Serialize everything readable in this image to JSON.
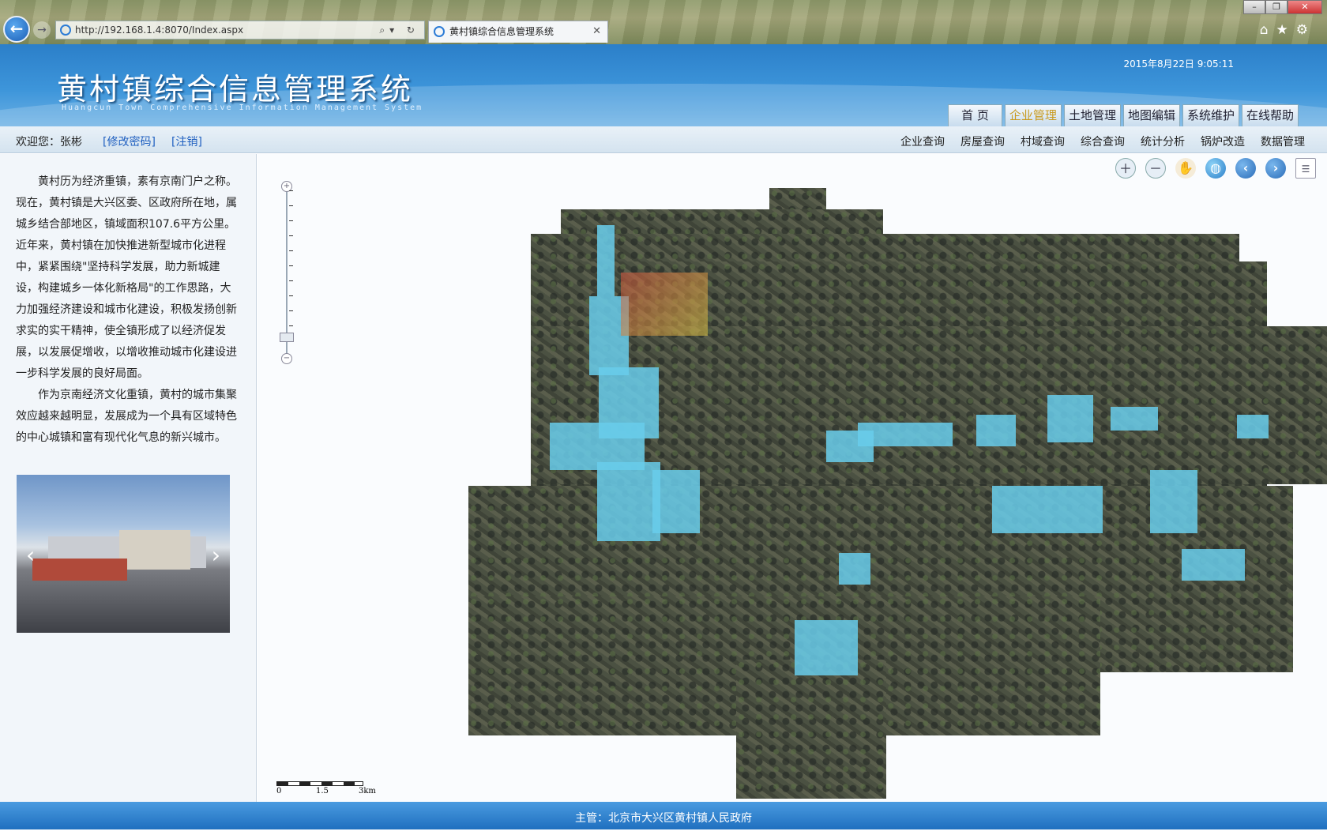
{
  "browser": {
    "url": "http://192.168.1.4:8070/Index.aspx",
    "tab_title": "黄村镇综合信息管理系统",
    "window_buttons": [
      "–",
      "❐",
      "✕"
    ]
  },
  "header": {
    "title_cn": "黄村镇综合信息管理系统",
    "title_en": "Huangcun Town Comprehensive Information Management System",
    "datetime": "2015年8月22日 9:05:11",
    "main_nav": [
      "首 页",
      "企业管理",
      "土地管理",
      "地图编辑",
      "系统维护",
      "在线帮助"
    ],
    "active_nav": "企业管理"
  },
  "subbar": {
    "welcome": "欢迎您：张彬",
    "change_password": "[修改密码]",
    "logout": "[注销]",
    "sub_nav": [
      "企业查询",
      "房屋查询",
      "村域查询",
      "综合查询",
      "统计分析",
      "锅炉改造",
      "数据管理"
    ]
  },
  "sidebar": {
    "paragraphs": [
      "黄村历为经济重镇，素有京南门户之称。现在，黄村镇是大兴区委、区政府所在地，属城乡结合部地区，镇域面积107.6平方公里。近年来，黄村镇在加快推进新型城市化进程中，紧紧围绕\"坚持科学发展，助力新城建设，构建城乡一体化新格局\"的工作思路，大力加强经济建设和城市化建设，积极发扬创新求实的实干精神，使全镇形成了以经济促发展，以发展促增收，以增收推动城市化建设进一步科学发展的良好局面。",
      "作为京南经济文化重镇，黄村的城市集聚效应越来越明显，发展成为一个具有区域特色的中心城镇和富有现代化气息的新兴城市。"
    ],
    "photo_prev": "‹",
    "photo_next": "›"
  },
  "map": {
    "tools": [
      "zoom-in",
      "zoom-out",
      "pan",
      "full-extent",
      "previous-extent",
      "next-extent",
      "layer-list"
    ],
    "scale_labels": [
      "0",
      "1.5",
      "3km"
    ]
  },
  "footer": {
    "text": "主管：北京市大兴区黄村镇人民政府"
  },
  "colors": {
    "header_blue": "#2b7fc9",
    "active_nav": "#c89a20",
    "link_blue": "#2060c0",
    "highlight_cyan": "#69cdeb"
  }
}
